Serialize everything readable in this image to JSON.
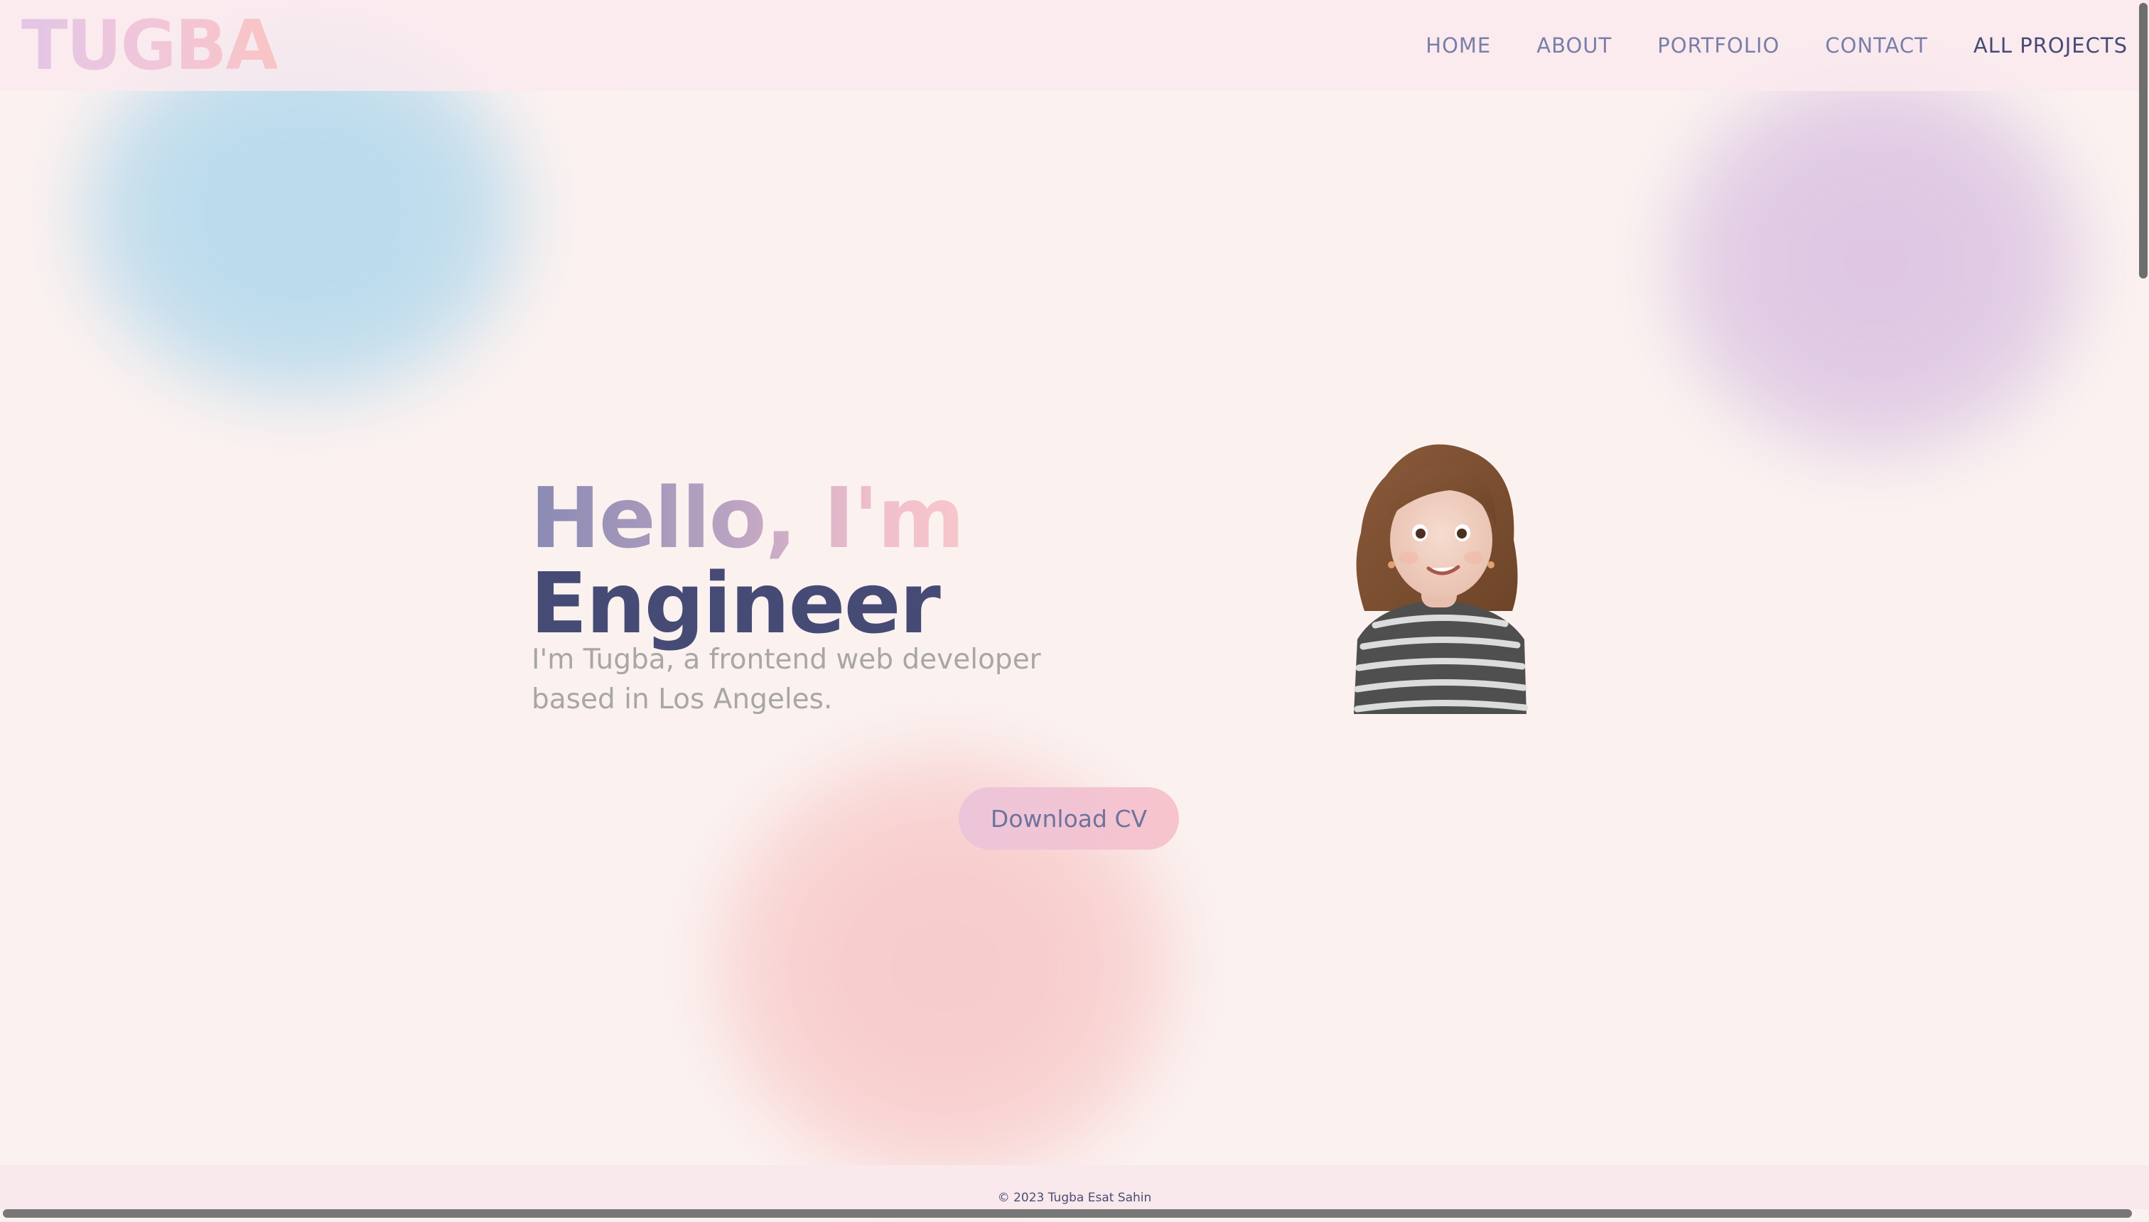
{
  "header": {
    "logo": "TUGBA",
    "nav": [
      {
        "label": "HOME"
      },
      {
        "label": "ABOUT"
      },
      {
        "label": "PORTFOLIO"
      },
      {
        "label": "CONTACT"
      },
      {
        "label": "ALL PROJECTS"
      }
    ]
  },
  "hero": {
    "greeting": "Hello, I'm",
    "role": "Engineer",
    "subtitle": "I'm Tugba, a frontend web developer based in Los Angeles.",
    "cv_button": "Download CV"
  },
  "footer": {
    "copyright": "© 2023 Tugba Esat Sahin"
  },
  "colors": {
    "background": "#fbf2f0",
    "nav_text": "#7a7fa8",
    "heading_dark": "#464b75",
    "subtitle": "#a8a6a6",
    "blob_blue": "#bedcec",
    "blob_purple": "#e0cbe4",
    "blob_pink": "#f8d0cf"
  },
  "icons": {
    "avatar": "memoji-avatar-icon"
  }
}
